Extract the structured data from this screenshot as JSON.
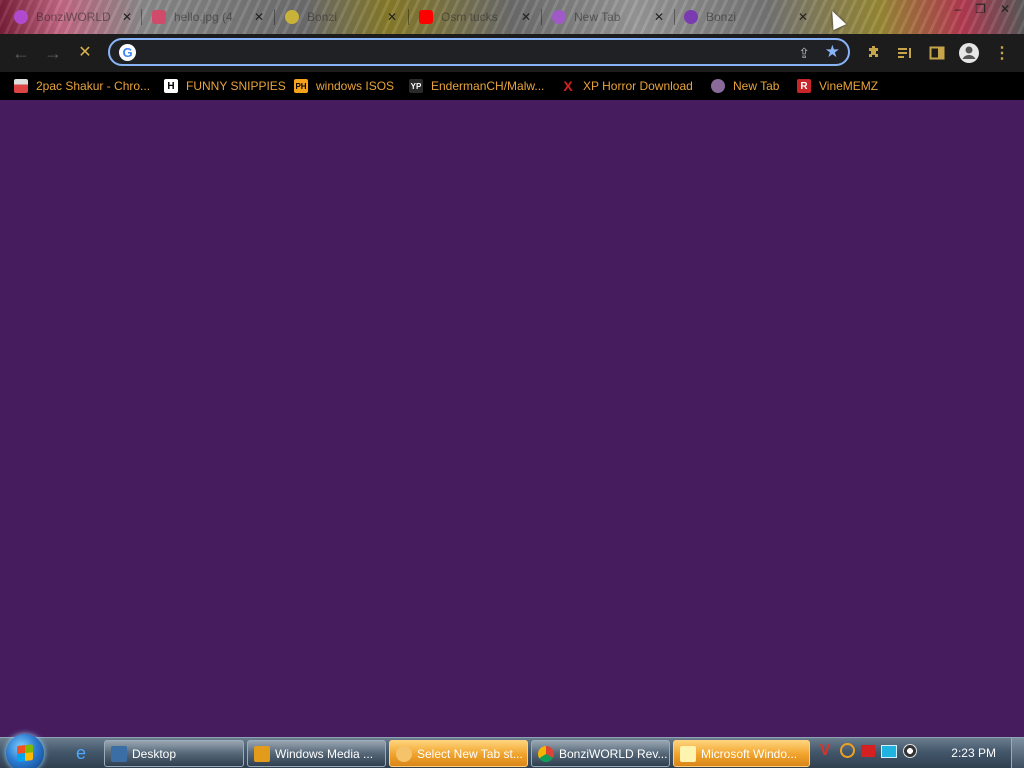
{
  "tabs": [
    {
      "title": "BonziWORLD",
      "favicon_color": "#b04bd0"
    },
    {
      "title": "hello.jpg (4",
      "favicon_color": "#d04a6a"
    },
    {
      "title": "Bonzi",
      "favicon_color": "#c8b23a"
    },
    {
      "title": "Osm tucks",
      "favicon_color": "#ff0000"
    },
    {
      "title": "New Tab",
      "favicon_color": "#a05ac8"
    },
    {
      "title": "Bonzi",
      "favicon_color": "#7a3ab0"
    }
  ],
  "window_controls": {
    "minimize": "–",
    "maximize": "❐",
    "close": "✕"
  },
  "toolbar": {
    "back": "←",
    "forward": "→",
    "stop": "✕",
    "omnibox_value": "",
    "omnibox_placeholder": "",
    "share": "⇪",
    "star": "★"
  },
  "bookmarks": [
    {
      "label": "2pac Shakur - Chro...",
      "icon_text": "",
      "icon_color": "#e0e0e0"
    },
    {
      "label": "FUNNY SNIPPIES",
      "icon_text": "H",
      "icon_color": "#ffffff"
    },
    {
      "label": "windows ISOS",
      "icon_text": "PH",
      "icon_color": "#f7a21b"
    },
    {
      "label": "EndermanCH/Malw...",
      "icon_text": "YP",
      "icon_color": "#2a2a2a"
    },
    {
      "label": "XP Horror Download",
      "icon_text": "X",
      "icon_color": "#d62020"
    },
    {
      "label": "New Tab",
      "icon_text": "",
      "icon_color": "#8a6a9a"
    },
    {
      "label": "VineMEMZ",
      "icon_text": "R",
      "icon_color": "#c8252a"
    }
  ],
  "taskbar": {
    "tasks": [
      {
        "label": "Desktop",
        "style": "normal"
      },
      {
        "label": "Windows Media ...",
        "style": "normal"
      },
      {
        "label": "Select New Tab st...",
        "style": "orange"
      },
      {
        "label": "BonziWORLD Rev...",
        "style": "normal"
      },
      {
        "label": "Microsoft Windo...",
        "style": "orange"
      }
    ],
    "clock": "2:23 PM"
  },
  "colors": {
    "page_background": "#461c5f",
    "bookmark_text": "#e8a33c",
    "accent": "#8ab4f8"
  }
}
